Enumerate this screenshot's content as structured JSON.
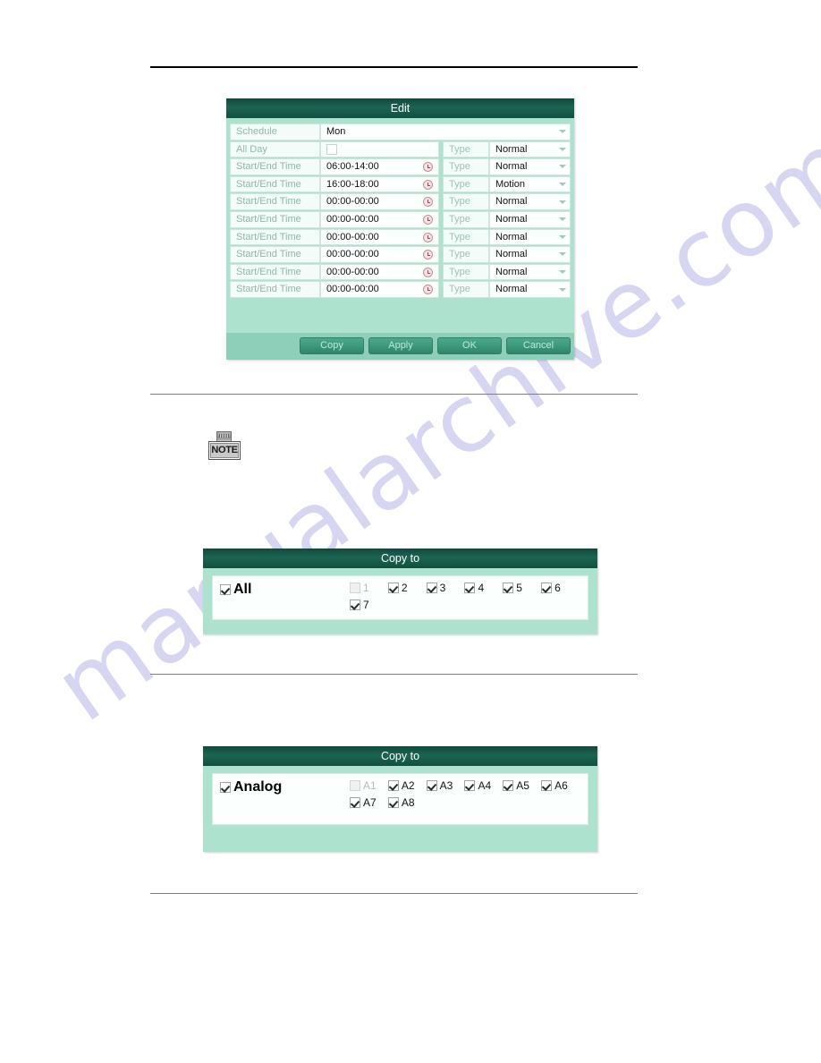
{
  "watermark": {
    "text": "manualarchive.com"
  },
  "note": {
    "label": "NOTE",
    "icon": "note-icon"
  },
  "edit_dialog": {
    "title": "Edit",
    "schedule": {
      "label": "Schedule",
      "value": "Mon"
    },
    "all_day": {
      "label": "All Day",
      "checked": false,
      "type_label": "Type",
      "type_value": "Normal"
    },
    "time_rows": [
      {
        "label": "Start/End Time",
        "value": "06:00-14:00",
        "type_label": "Type",
        "type_value": "Normal"
      },
      {
        "label": "Start/End Time",
        "value": "16:00-18:00",
        "type_label": "Type",
        "type_value": "Motion"
      },
      {
        "label": "Start/End Time",
        "value": "00:00-00:00",
        "type_label": "Type",
        "type_value": "Normal"
      },
      {
        "label": "Start/End Time",
        "value": "00:00-00:00",
        "type_label": "Type",
        "type_value": "Normal"
      },
      {
        "label": "Start/End Time",
        "value": "00:00-00:00",
        "type_label": "Type",
        "type_value": "Normal"
      },
      {
        "label": "Start/End Time",
        "value": "00:00-00:00",
        "type_label": "Type",
        "type_value": "Normal"
      },
      {
        "label": "Start/End Time",
        "value": "00:00-00:00",
        "type_label": "Type",
        "type_value": "Normal"
      },
      {
        "label": "Start/End Time",
        "value": "00:00-00:00",
        "type_label": "Type",
        "type_value": "Normal"
      }
    ],
    "buttons": {
      "copy": "Copy",
      "apply": "Apply",
      "ok": "OK",
      "cancel": "Cancel"
    }
  },
  "copy_to_ip": {
    "title": "Copy to",
    "all": {
      "label": "All",
      "checked": true
    },
    "channels": [
      {
        "label": "1",
        "checked": false,
        "disabled": true
      },
      {
        "label": "2",
        "checked": true,
        "disabled": false
      },
      {
        "label": "3",
        "checked": true,
        "disabled": false
      },
      {
        "label": "4",
        "checked": true,
        "disabled": false
      },
      {
        "label": "5",
        "checked": true,
        "disabled": false
      },
      {
        "label": "6",
        "checked": true,
        "disabled": false
      },
      {
        "label": "7",
        "checked": true,
        "disabled": false
      }
    ]
  },
  "copy_to_analog": {
    "title": "Copy to",
    "all": {
      "label": "Analog",
      "checked": true
    },
    "channels": [
      {
        "label": "A1",
        "checked": false,
        "disabled": true
      },
      {
        "label": "A2",
        "checked": true,
        "disabled": false
      },
      {
        "label": "A3",
        "checked": true,
        "disabled": false
      },
      {
        "label": "A4",
        "checked": true,
        "disabled": false
      },
      {
        "label": "A5",
        "checked": true,
        "disabled": false
      },
      {
        "label": "A6",
        "checked": true,
        "disabled": false
      },
      {
        "label": "A7",
        "checked": true,
        "disabled": false
      },
      {
        "label": "A8",
        "checked": true,
        "disabled": false
      }
    ]
  },
  "colors": {
    "title_bar_dark": "#12503f",
    "dialog_body": "#ade2cf",
    "panel_white": "#fbfffd",
    "button_green": "#3c997c",
    "watermark": "#cfcef0"
  }
}
